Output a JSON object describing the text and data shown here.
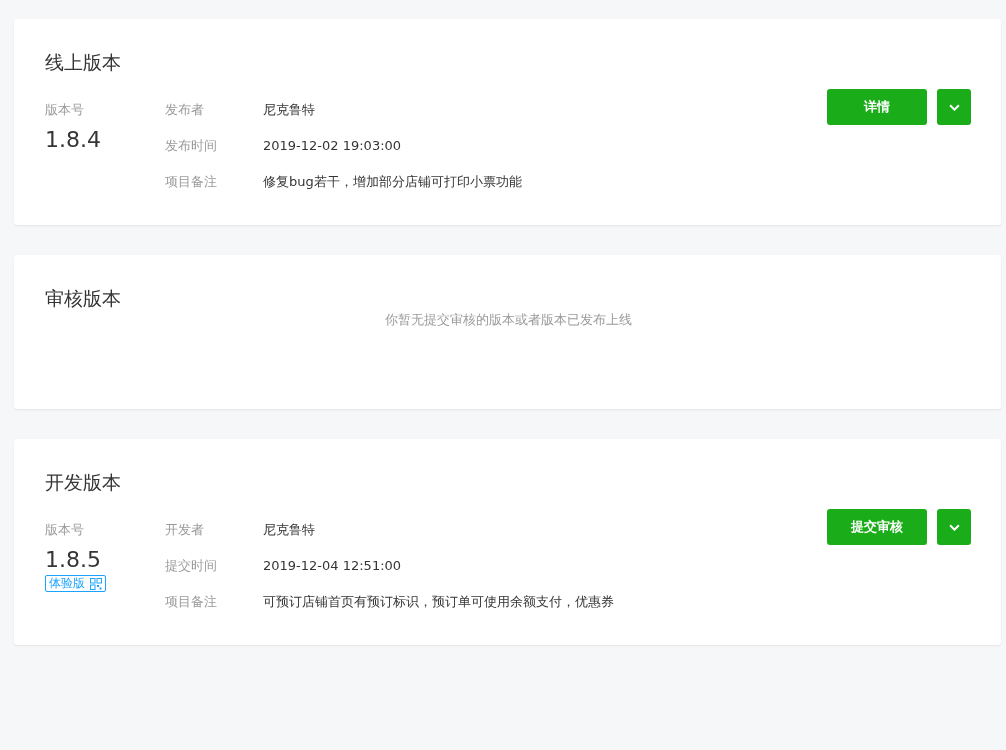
{
  "sections": [
    {
      "kind": "version",
      "title": "线上版本",
      "version_label": "版本号",
      "version": "1.8.4",
      "fields": [
        {
          "label": "发布者",
          "value": "尼克鲁特"
        },
        {
          "label": "发布时间",
          "value": "2019-12-02 19:03:00"
        },
        {
          "label": "项目备注",
          "value": "修复bug若干，增加部分店铺可打印小票功能"
        }
      ],
      "button": "详情"
    },
    {
      "kind": "empty",
      "title": "审核版本",
      "message": "你暂无提交审核的版本或者版本已发布上线"
    },
    {
      "kind": "version",
      "title": "开发版本",
      "version_label": "版本号",
      "version": "1.8.5",
      "badge": "体验版",
      "fields": [
        {
          "label": "开发者",
          "value": "尼克鲁特"
        },
        {
          "label": "提交时间",
          "value": "2019-12-04 12:51:00"
        },
        {
          "label": "项目备注",
          "value": "可预订店铺首页有预订标识，预订单可使用余额支付，优惠券"
        }
      ],
      "button": "提交审核"
    }
  ]
}
